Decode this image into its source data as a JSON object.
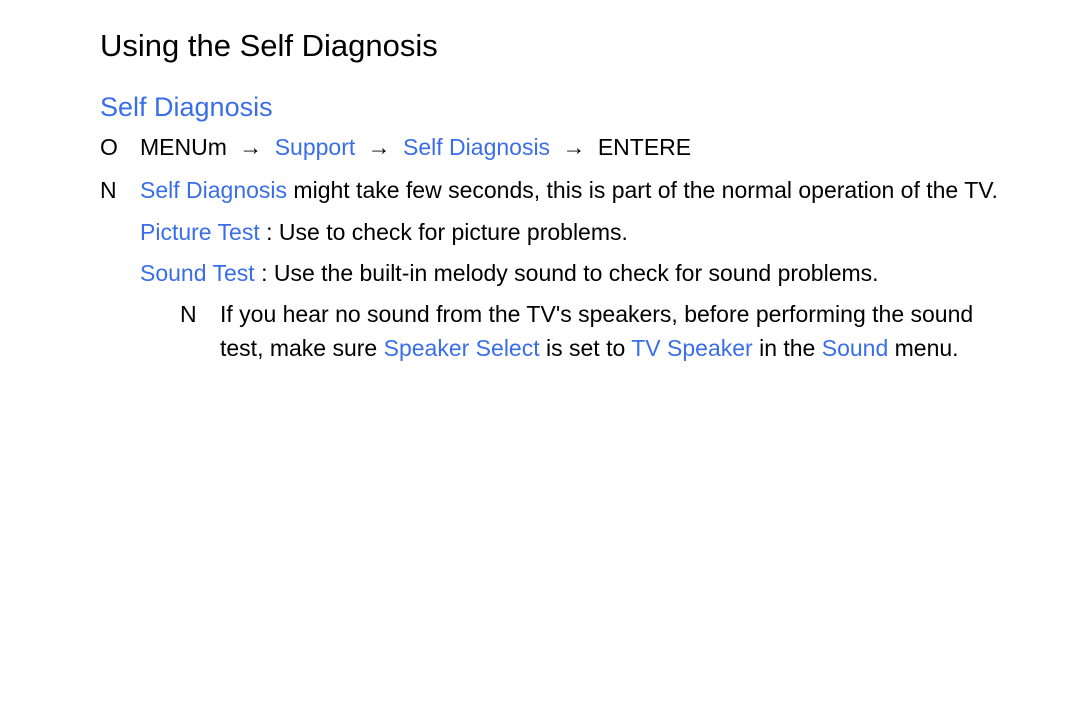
{
  "title": "Using the Self Diagnosis",
  "subtitle": "Self Diagnosis",
  "nav": {
    "bullet": "O",
    "menu": "MENU",
    "menu_suffix": "m",
    "sep": " → ",
    "support": "Support",
    "self_diag": "Self Diagnosis",
    "enter": "ENTER",
    "enter_suffix": "E"
  },
  "note1": {
    "bullet": "N",
    "lead": "Self Diagnosis",
    "rest": " might take few seconds, this is part of the normal operation of the TV."
  },
  "picture": {
    "lead": "Picture Test",
    "colon": ": ",
    "rest": "Use to check for picture problems."
  },
  "sound": {
    "lead": "Sound Test",
    "colon": ": ",
    "rest": "Use the built-in melody sound to check for sound problems."
  },
  "note2": {
    "bullet": "N",
    "t1": "If you hear no sound from the TV's speakers, before performing the sound test, make sure ",
    "speaker_select": "Speaker Select",
    "t2": " is set to ",
    "tv_speaker": "TV Speaker",
    "t3": " in the ",
    "sound_menu": "Sound",
    "t4": " menu."
  }
}
